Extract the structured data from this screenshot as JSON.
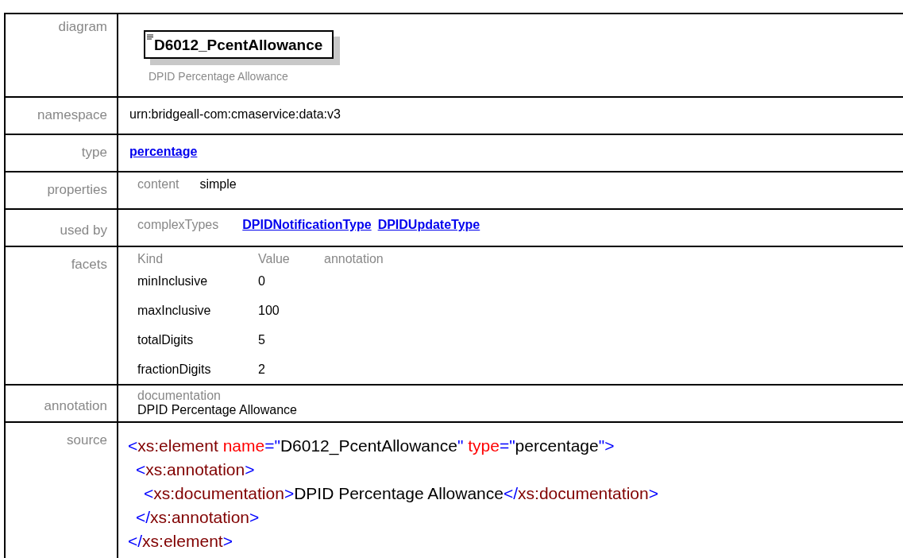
{
  "diagram": {
    "label": "diagram",
    "element_name": "D6012_PcentAllowance",
    "caption": "DPID Percentage Allowance"
  },
  "namespace": {
    "label": "namespace",
    "value": "urn:bridgeall-com:cmaservice:data:v3"
  },
  "type": {
    "label": "type",
    "link": "percentage"
  },
  "properties": {
    "label": "properties",
    "key": "content",
    "value": "simple"
  },
  "used_by": {
    "label": "used by",
    "key": "complexTypes",
    "links": [
      "DPIDNotificationType",
      "DPIDUpdateType"
    ]
  },
  "facets": {
    "label": "facets",
    "columns": [
      "Kind",
      "Value",
      "annotation"
    ],
    "rows": [
      {
        "kind": "minInclusive",
        "value": "0"
      },
      {
        "kind": "maxInclusive",
        "value": "100"
      },
      {
        "kind": "totalDigits",
        "value": "5"
      },
      {
        "kind": "fractionDigits",
        "value": "2"
      }
    ]
  },
  "annotation": {
    "label": "annotation",
    "key": "documentation",
    "value": "DPID Percentage Allowance"
  },
  "source": {
    "label": "source",
    "lines": [
      {
        "tokens": [
          {
            "kind": "punct",
            "text": "<"
          },
          {
            "kind": "tag",
            "text": "xs:element"
          },
          {
            "kind": "attr",
            "text": " name"
          },
          {
            "kind": "punct",
            "text": "=\""
          },
          {
            "kind": "text",
            "text": "D6012_PcentAllowance"
          },
          {
            "kind": "punct",
            "text": "\""
          },
          {
            "kind": "attr",
            "text": " type"
          },
          {
            "kind": "punct",
            "text": "=\""
          },
          {
            "kind": "text",
            "text": "percentage"
          },
          {
            "kind": "punct",
            "text": "\">"
          }
        ],
        "children": [
          {
            "tokens": [
              {
                "kind": "punct",
                "text": "<"
              },
              {
                "kind": "tag",
                "text": "xs:annotation"
              },
              {
                "kind": "punct",
                "text": ">"
              }
            ],
            "children": [
              {
                "tokens": [
                  {
                    "kind": "punct",
                    "text": "<"
                  },
                  {
                    "kind": "tag",
                    "text": "xs:documentation"
                  },
                  {
                    "kind": "punct",
                    "text": ">"
                  },
                  {
                    "kind": "text",
                    "text": "DPID Percentage Allowance"
                  },
                  {
                    "kind": "punct",
                    "text": "</"
                  },
                  {
                    "kind": "tag",
                    "text": "xs:documentation"
                  },
                  {
                    "kind": "punct",
                    "text": ">"
                  }
                ]
              }
            ]
          },
          {
            "tokens": [
              {
                "kind": "punct",
                "text": "</"
              },
              {
                "kind": "tag",
                "text": "xs:annotation"
              },
              {
                "kind": "punct",
                "text": ">"
              }
            ]
          }
        ]
      },
      {
        "tokens": [
          {
            "kind": "punct",
            "text": "</"
          },
          {
            "kind": "tag",
            "text": "xs:element"
          },
          {
            "kind": "punct",
            "text": ">"
          }
        ]
      }
    ]
  }
}
